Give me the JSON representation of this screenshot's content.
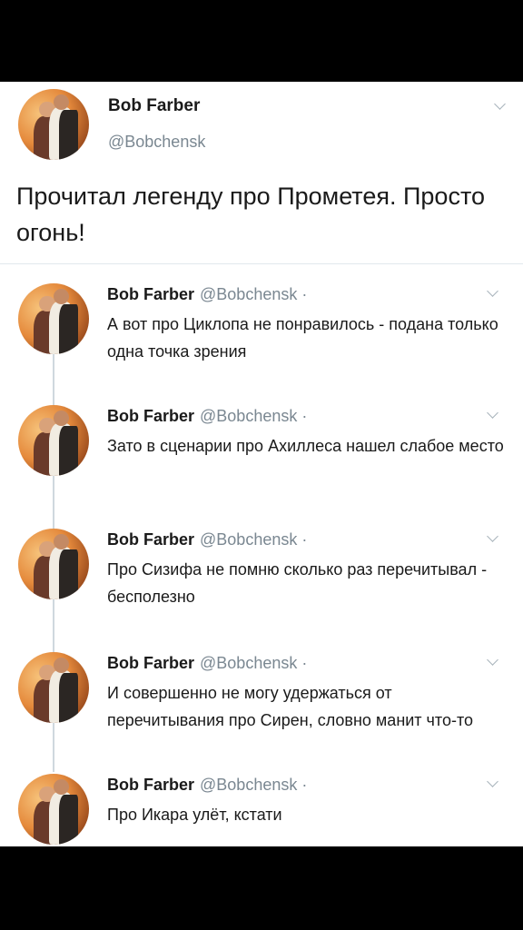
{
  "main_tweet": {
    "name": "Bob Farber",
    "handle": "@Bobchensk",
    "text": "Прочитал легенду про Прометея. Просто огонь!"
  },
  "replies": [
    {
      "name": "Bob Farber",
      "handle": "@Bobchensk ·",
      "text": "А вот про Циклопа не понравилось - подана только одна точка зрения"
    },
    {
      "name": "Bob Farber",
      "handle": "@Bobchensk ·",
      "text": "Зато в сценарии про Ахиллеса нашел слабое место"
    },
    {
      "name": "Bob Farber",
      "handle": "@Bobchensk ·",
      "text": "Про Сизифа не помню сколько раз перечитывал - бесполезно"
    },
    {
      "name": "Bob Farber",
      "handle": "@Bobchensk ·",
      "text": "И совершенно не могу удержаться от перечитывания про Сирен, словно манит что-то"
    },
    {
      "name": "Bob Farber",
      "handle": "@Bobchensk ·",
      "text": "Про Икара улёт, кстати"
    }
  ],
  "icons": {
    "avatar": "avatar-image",
    "menu": "chevron-down-icon"
  }
}
